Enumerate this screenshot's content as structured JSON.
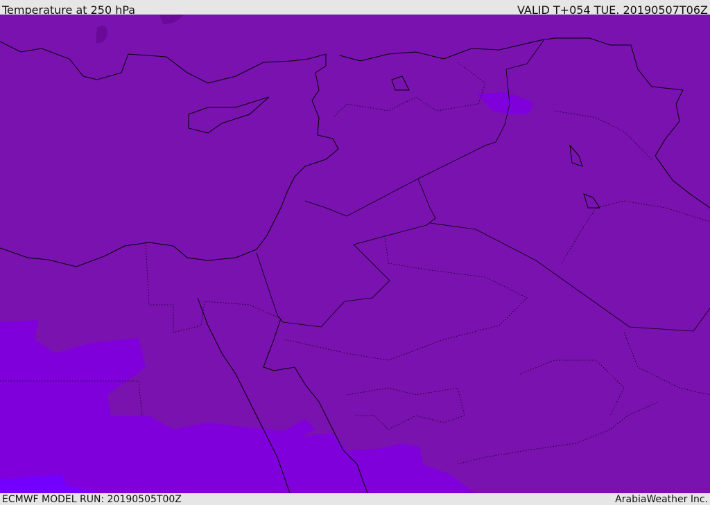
{
  "header": {
    "title": "Temperature at 250 hPa",
    "valid": "VALID T+054 TUE. 20190507T06Z"
  },
  "footer": {
    "model_run": "ECMWF MODEL RUN: 20190505T00Z",
    "credit": "ArabiaWeather Inc."
  },
  "colors": {
    "base": "#7a12b0",
    "warmer": "#7f00da",
    "warmest": "#7300ff",
    "cold_patch": "#6a0a9a"
  }
}
